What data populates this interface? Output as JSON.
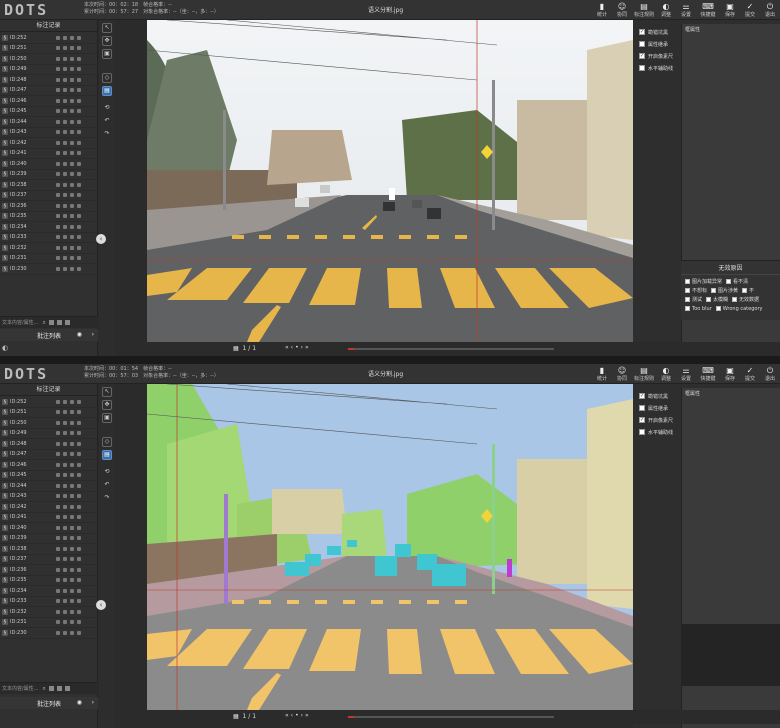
{
  "app": {
    "logo": "DOTS",
    "filename": "语义分割.jpg"
  },
  "toolbar": [
    {
      "label": "统计",
      "icon": "chart-icon"
    },
    {
      "label": "协同",
      "icon": "users-icon"
    },
    {
      "label": "标注规则",
      "icon": "doc-icon"
    },
    {
      "label": "调整",
      "icon": "contrast-icon"
    },
    {
      "label": "设置",
      "icon": "sliders-icon"
    },
    {
      "label": "快捷键",
      "icon": "keyboard-icon"
    },
    {
      "label": "保存",
      "icon": "save-icon"
    },
    {
      "label": "提交",
      "icon": "check-icon"
    },
    {
      "label": "退出",
      "icon": "exit-icon"
    }
  ],
  "panelA": {
    "meta_line1": [
      "本次时间：00：02：18",
      "帧合格率：--"
    ],
    "meta_line2": [
      "累计时间：00：57：27",
      "对象合格率：--（坐：--，多：--）"
    ],
    "invalid_visible": true
  },
  "panelB": {
    "meta_line1": [
      "本次时间：00：01：54",
      "帧合格率：--"
    ],
    "meta_line2": [
      "累计时间：00：57：03",
      "对象合格率：--（坐：--，多：--）"
    ],
    "invalid_visible": false
  },
  "sidebar": {
    "title": "标注记录",
    "rows": [
      "ID:252",
      "ID:251",
      "ID:250",
      "ID:249",
      "ID:248",
      "ID:247",
      "ID:246",
      "ID:245",
      "ID:244",
      "ID:243",
      "ID:242",
      "ID:241",
      "ID:240",
      "ID:239",
      "ID:238",
      "ID:237",
      "ID:236",
      "ID:235",
      "ID:234",
      "ID:233",
      "ID:232",
      "ID:231",
      "ID:230"
    ],
    "search_placeholder": "文本内容/属性...",
    "footer_label": "批注列表"
  },
  "checks": [
    {
      "label": "勘错坑黑",
      "checked": true
    },
    {
      "label": "属性继承",
      "checked": false
    },
    {
      "label": "开启像素尺",
      "checked": true
    },
    {
      "label": "水平辅助线",
      "checked": false
    }
  ],
  "attr_title": "框属性",
  "invalid": {
    "title": "无效原因",
    "items": [
      "图片加载异常",
      "看不清",
      "不想标",
      "图片涉黄",
      "不",
      "测试",
      "太模糊",
      "无效数据",
      "Too blur",
      "Wrong category"
    ]
  },
  "pagination": {
    "current": "1",
    "sep": "/",
    "total": "1",
    "icon": "image-icon"
  },
  "zoom": [
    "缩",
    "+",
    "-"
  ]
}
